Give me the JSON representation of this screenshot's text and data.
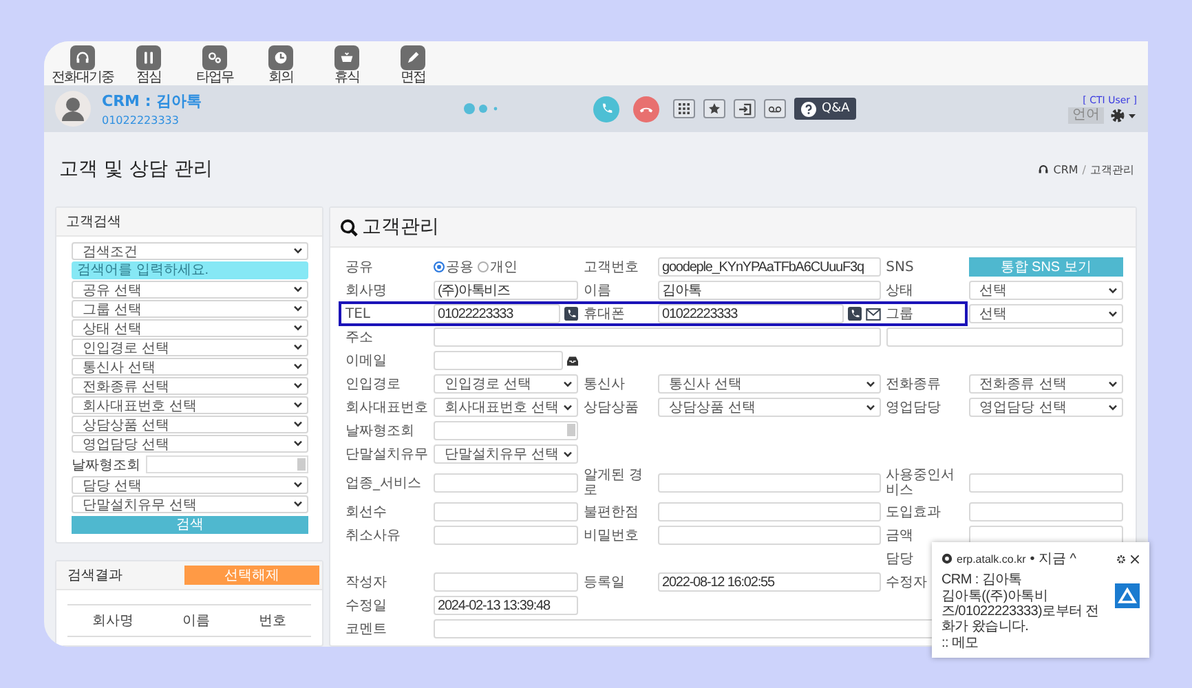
{
  "toolbar": [
    {
      "kind": "headset",
      "label": "전화대기중"
    },
    {
      "kind": "utensils",
      "label": "점심"
    },
    {
      "kind": "gears",
      "label": "타업무"
    },
    {
      "kind": "clock",
      "label": "회의"
    },
    {
      "kind": "cup",
      "label": "휴식"
    },
    {
      "kind": "pencil",
      "label": "면접"
    }
  ],
  "header": {
    "title": "CRM : 김아톡",
    "number": "01022223333",
    "cti_label": "[ CTI User ]",
    "language_button": "언어",
    "qa_button": "Q&A"
  },
  "page": {
    "title": "고객 및 상담 관리",
    "breadcrumb": [
      "CRM",
      "고객관리"
    ],
    "breadcrumb_separator": "/"
  },
  "search_panel": {
    "title": "고객검색",
    "filters": [
      {
        "kind": "select",
        "value": "검색조건"
      },
      {
        "kind": "input",
        "placeholder": "검색어를 입력하세요."
      },
      {
        "kind": "select",
        "value": "공유 선택"
      },
      {
        "kind": "select",
        "value": "그룹 선택"
      },
      {
        "kind": "select",
        "value": "상태 선택"
      },
      {
        "kind": "select",
        "value": "인입경로 선택"
      },
      {
        "kind": "select",
        "value": "통신사 선택"
      },
      {
        "kind": "select",
        "value": "전화종류 선택"
      },
      {
        "kind": "select",
        "value": "회사대표번호 선택"
      },
      {
        "kind": "select",
        "value": "상담상품 선택"
      },
      {
        "kind": "select",
        "value": "영업담당 선택"
      },
      {
        "kind": "date",
        "label": "날짜형조회"
      },
      {
        "kind": "select",
        "value": "담당 선택"
      },
      {
        "kind": "select",
        "value": "단말설치유무 선택"
      },
      {
        "kind": "button",
        "value": "검색"
      }
    ]
  },
  "results_panel": {
    "title": "검색결과",
    "clear_button": "선택해제",
    "columns": [
      "회사명",
      "이름",
      "번호"
    ]
  },
  "form": {
    "title": "고객관리",
    "rows": [
      {
        "highlighted": false,
        "fields": [
          {
            "label": "공유",
            "kind": "radio",
            "options": [
              {
                "label": "공용",
                "selected": true
              },
              {
                "label": "개인",
                "selected": false
              }
            ]
          },
          {
            "label": "고객번호",
            "kind": "text",
            "value": "goodeple_KYnYPAaTFbA6CUuuF3q"
          },
          {
            "label": "SNS",
            "kind": "button",
            "value": "통합 SNS 보기"
          }
        ]
      },
      {
        "highlighted": false,
        "fields": [
          {
            "label": "회사명",
            "kind": "text",
            "value": "(주)아톡비즈"
          },
          {
            "label": "이름",
            "kind": "text",
            "value": "김아톡"
          },
          {
            "label": "상태",
            "kind": "select",
            "value": "선택"
          }
        ]
      },
      {
        "highlighted": true,
        "fields": [
          {
            "label": "TEL",
            "kind": "phone",
            "value": "01022223333"
          },
          {
            "label": "휴대폰",
            "kind": "phone_mail",
            "value": "01022223333"
          },
          {
            "label": "그룹",
            "kind": "select",
            "value": "선택"
          }
        ]
      },
      {
        "highlighted": false,
        "fields": [
          {
            "label": "주소",
            "kind": "address"
          }
        ]
      },
      {
        "highlighted": false,
        "fields": [
          {
            "label": "이메일",
            "kind": "email"
          }
        ]
      },
      {
        "highlighted": false,
        "fields": [
          {
            "label": "인입경로",
            "kind": "select",
            "value": "인입경로 선택"
          },
          {
            "label": "통신사",
            "kind": "select",
            "value": "통신사 선택"
          },
          {
            "label": "전화종류",
            "kind": "select",
            "value": "전화종류 선택"
          }
        ]
      },
      {
        "highlighted": false,
        "fields": [
          {
            "label": "회사대표번호",
            "kind": "select",
            "value": "회사대표번호 선택"
          },
          {
            "label": "상담상품",
            "kind": "select",
            "value": "상담상품 선택"
          },
          {
            "label": "영업담당",
            "kind": "select",
            "value": "영업담당 선택"
          }
        ]
      },
      {
        "highlighted": false,
        "fields": [
          {
            "label": "날짜형조회",
            "kind": "date"
          }
        ]
      },
      {
        "highlighted": false,
        "fields": [
          {
            "label": "단말설치유무",
            "kind": "select",
            "value": "단말설치유무 선택"
          }
        ]
      },
      {
        "highlighted": false,
        "fields": [
          {
            "label": "업종_서비스",
            "kind": "text"
          },
          {
            "label": "알게된 경로",
            "kind": "text"
          },
          {
            "label": "사용중인서비스",
            "kind": "text"
          }
        ]
      },
      {
        "highlighted": false,
        "fields": [
          {
            "label": "회선수",
            "kind": "text"
          },
          {
            "label": "불편한점",
            "kind": "text"
          },
          {
            "label": "도입효과",
            "kind": "text"
          }
        ]
      },
      {
        "highlighted": false,
        "fields": [
          {
            "label": "취소사유",
            "kind": "text"
          },
          {
            "label": "비밀번호",
            "kind": "text"
          },
          {
            "label": "금액",
            "kind": "text"
          }
        ]
      },
      {
        "highlighted": false,
        "fields": [
          {
            "kind": "blank"
          },
          {
            "kind": "blank"
          },
          {
            "label": "담당",
            "kind": "label"
          }
        ]
      },
      {
        "highlighted": false,
        "fields": [
          {
            "label": "작성자",
            "kind": "text"
          },
          {
            "label": "등록일",
            "kind": "text",
            "value": "2022-08-12 16:02:55"
          },
          {
            "label": "수정자",
            "kind": "label"
          }
        ]
      },
      {
        "highlighted": false,
        "fields": [
          {
            "label": "수정일",
            "kind": "text",
            "value": "2024-02-13 13:39:48"
          }
        ]
      },
      {
        "highlighted": false,
        "fields": [
          {
            "label": "코멘트",
            "kind": "wide"
          }
        ]
      }
    ]
  },
  "notification": {
    "source": "erp.atalk.co.kr",
    "meta": "• 지금 ^",
    "title": "CRM : 김아톡",
    "message": "김아톡((주)아톡비즈/01022223333)로부터 전화가 왔습니다.",
    "memo": ":: 메모"
  }
}
